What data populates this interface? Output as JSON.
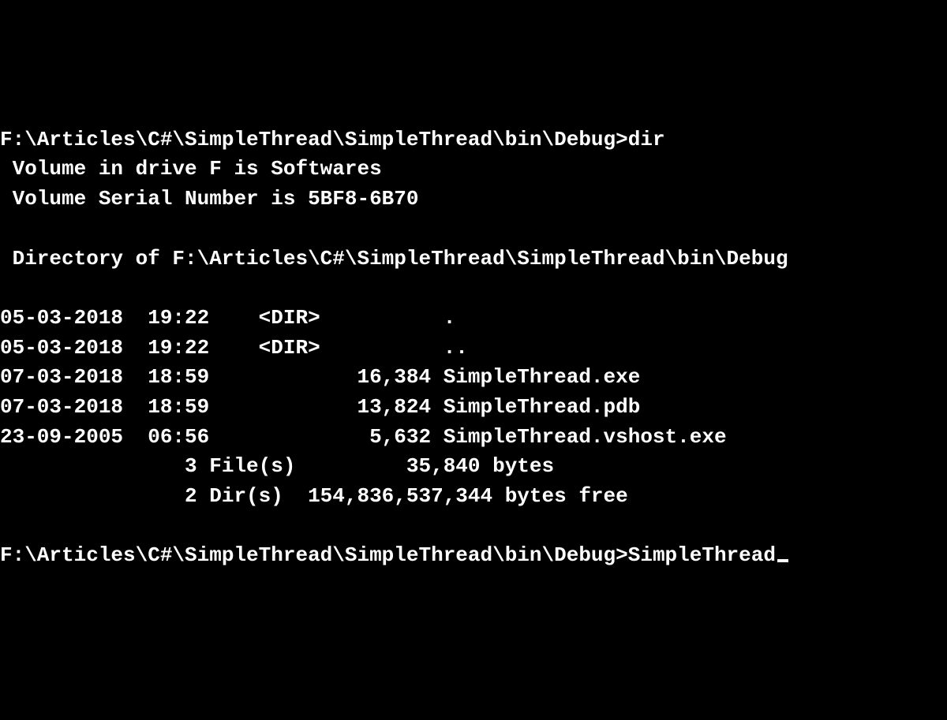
{
  "prompt1": {
    "path": "F:\\Articles\\C#\\SimpleThread\\SimpleThread\\bin\\Debug>",
    "command": "dir"
  },
  "volume_line": " Volume in drive F is Softwares",
  "serial_line": " Volume Serial Number is 5BF8-6B70",
  "directory_line": " Directory of F:\\Articles\\C#\\SimpleThread\\SimpleThread\\bin\\Debug",
  "entries": [
    "05-03-2018  19:22    <DIR>          .",
    "05-03-2018  19:22    <DIR>          ..",
    "07-03-2018  18:59            16,384 SimpleThread.exe",
    "07-03-2018  18:59            13,824 SimpleThread.pdb",
    "23-09-2005  06:56             5,632 SimpleThread.vshost.exe"
  ],
  "summary_files": "               3 File(s)         35,840 bytes",
  "summary_dirs": "               2 Dir(s)  154,836,537,344 bytes free",
  "prompt2": {
    "path": "F:\\Articles\\C#\\SimpleThread\\SimpleThread\\bin\\Debug>",
    "command": "SimpleThread"
  }
}
